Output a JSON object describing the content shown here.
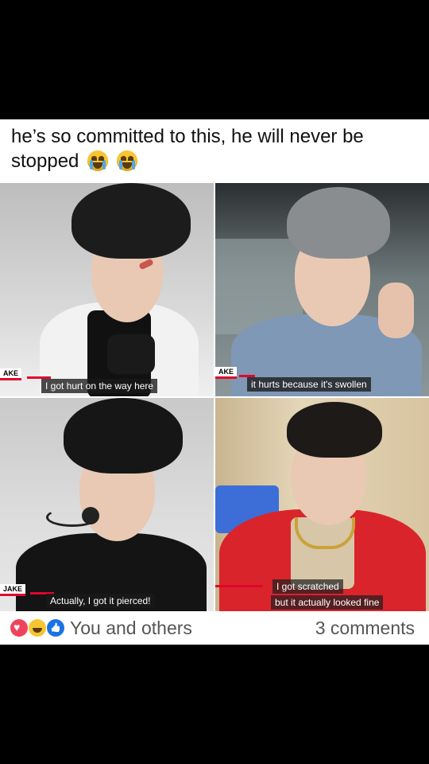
{
  "post": {
    "caption": "he’s so committed to this, he will never be stopped",
    "emojis": [
      "crying-face",
      "crying-face"
    ]
  },
  "panels": [
    {
      "name_tag": "AKE",
      "subtitle": "I got hurt on the way here"
    },
    {
      "name_tag": "AKE",
      "subtitle": "it hurts because it's swollen"
    },
    {
      "name_tag": "JAKE",
      "subtitle": "Actually, I got it pierced!"
    },
    {
      "name_tag": "",
      "subtitle_line1": "I got scratched",
      "subtitle_line2": "but it actually looked fine"
    }
  ],
  "footer": {
    "reactions": [
      "love-icon",
      "haha-icon",
      "like-icon"
    ],
    "reactors": "You and others",
    "comments": "3 comments"
  },
  "colors": {
    "accent_red": "#e1062d",
    "like_blue": "#1b74e4",
    "love_red": "#f0435b",
    "haha_yellow": "#f7c531"
  }
}
